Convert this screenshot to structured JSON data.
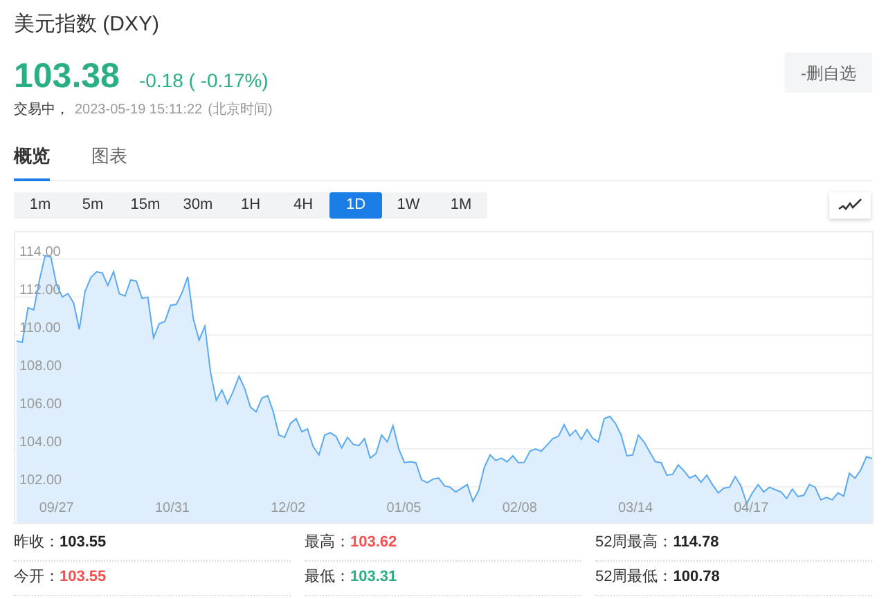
{
  "header": {
    "title": "美元指数 (DXY)",
    "price": "103.38",
    "change": "-0.18 ( -0.17%)",
    "status": "交易中，",
    "timestamp": "2023-05-19 15:11:22",
    "timezone": "(北京时间)",
    "watchlist_button": "-删自选"
  },
  "tabs": [
    {
      "label": "概览",
      "selected": true
    },
    {
      "label": "图表",
      "selected": false
    }
  ],
  "intervals": [
    {
      "label": "1m",
      "selected": false
    },
    {
      "label": "5m",
      "selected": false
    },
    {
      "label": "15m",
      "selected": false
    },
    {
      "label": "30m",
      "selected": false
    },
    {
      "label": "1H",
      "selected": false
    },
    {
      "label": "4H",
      "selected": false
    },
    {
      "label": "1D",
      "selected": true
    },
    {
      "label": "1W",
      "selected": false
    },
    {
      "label": "1M",
      "selected": false
    }
  ],
  "chart": {
    "chart_data": {
      "type": "area",
      "grid": true,
      "series": [
        {
          "color": "#5aa9f5",
          "values": [
            109.68,
            109.61,
            111.44,
            111.32,
            112.9,
            114.17,
            114.12,
            112.66,
            112,
            112.17,
            111.68,
            110.29,
            112.29,
            113.02,
            113.32,
            113.27,
            112.61,
            113.34,
            112.17,
            112.05,
            112.9,
            112.83,
            111.93,
            111.98,
            109.85,
            110.59,
            110.71,
            111.56,
            111.61,
            112.22,
            113.07,
            110.83,
            109.73,
            110.46,
            108.02,
            106.56,
            107.1,
            106.37,
            107.05,
            107.83,
            107.17,
            106.2,
            105.95,
            106.68,
            106.8,
            105.95,
            104.73,
            104.61,
            105.34,
            105.59,
            104.9,
            105.05,
            104.12,
            103.68,
            104.73,
            104.85,
            104.66,
            104.05,
            104.61,
            104.24,
            104.17,
            104.54,
            103.51,
            103.76,
            104.73,
            104.37,
            105.22,
            104,
            103.27,
            103.32,
            103.27,
            102.37,
            102.22,
            102.41,
            102.46,
            102.05,
            101.98,
            101.73,
            101.93,
            102.12,
            101.24,
            101.8,
            103.02,
            103.68,
            103.39,
            103.51,
            103.32,
            103.63,
            103.27,
            103.29,
            103.88,
            104,
            103.88,
            104.2,
            104.54,
            104.66,
            105.27,
            104.68,
            104.98,
            104.49,
            105.02,
            104.56,
            104.37,
            105.59,
            105.71,
            105.34,
            104.73,
            103.63,
            103.68,
            104.73,
            104.37,
            103.83,
            103.32,
            103.27,
            102.61,
            102.66,
            103.15,
            102.85,
            102.46,
            102.61,
            102.24,
            102.61,
            102.12,
            101.68,
            101.93,
            101.98,
            102.54,
            102.05,
            101.12,
            101.68,
            102.12,
            101.73,
            101.98,
            101.85,
            101.73,
            101.39,
            101.88,
            101.49,
            101.56,
            102.12,
            101.98,
            101.32,
            101.44,
            101.32,
            101.68,
            101.51,
            102.71,
            102.46,
            102.9,
            103.59,
            103.49
          ]
        }
      ],
      "ylim": [
        100.1,
        115.4
      ],
      "yticks": [
        {
          "value": 102,
          "label": "102.00"
        },
        {
          "value": 104,
          "label": "104.00"
        },
        {
          "value": 106,
          "label": "106.00"
        },
        {
          "value": 108,
          "label": "108.00"
        },
        {
          "value": 110,
          "label": "110.00"
        },
        {
          "value": 112,
          "label": "112.00"
        },
        {
          "value": 114,
          "label": "114.00"
        }
      ]
    },
    "x_axis_labels": [
      "09/27",
      "10/31",
      "12/02",
      "01/05",
      "02/08",
      "03/14",
      "04/17"
    ]
  },
  "stats": [
    {
      "label": "昨收：",
      "value": "103.55",
      "color": "#222222"
    },
    {
      "label": "最高：",
      "value": "103.62",
      "color": "#f5504f"
    },
    {
      "label": "52周最高：",
      "value": "114.78",
      "color": "#222222"
    },
    {
      "label": "今开：",
      "value": "103.55",
      "color": "#f5504f"
    },
    {
      "label": "最低：",
      "value": "103.31",
      "color": "#2aae84"
    },
    {
      "label": "52周最低：",
      "value": "100.78",
      "color": "#222222"
    }
  ]
}
